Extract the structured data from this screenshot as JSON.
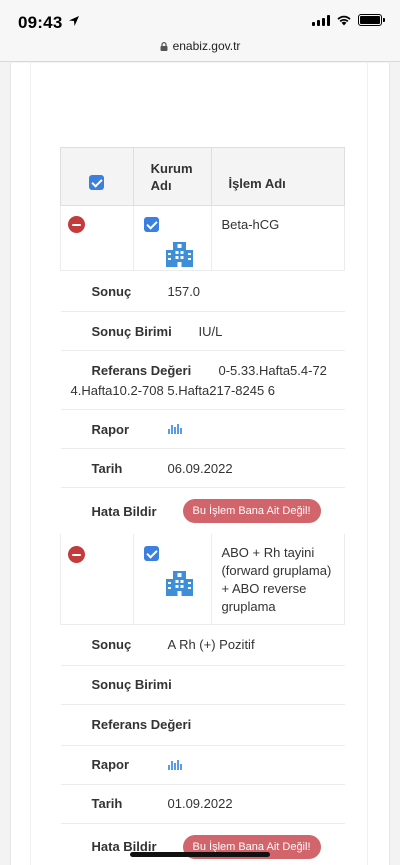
{
  "status_bar": {
    "time": "09:43"
  },
  "browser": {
    "url": "enabiz.gov.tr"
  },
  "table": {
    "header": {
      "kurum": "Kurum\nAdı",
      "islem": "İşlem Adı"
    },
    "labels": {
      "sonuc": "Sonuç",
      "sonuc_birimi": "Sonuç Birimi",
      "referans": "Referans Değeri",
      "rapor": "Rapor",
      "tarih": "Tarih",
      "hata": "Hata Bildir"
    },
    "error_button_label": "Bu İşlem Bana Ait Değil!",
    "records": [
      {
        "islem_adi": "Beta-hCG",
        "sonuc": "157.0",
        "sonuc_birimi": "IU/L",
        "referans_line1": "0-5.33.Hafta5.4-72",
        "referans_line2": "4.Hafta10.2-708 5.Hafta217-8245 6",
        "tarih": "06.09.2022"
      },
      {
        "islem_adi": "ABO + Rh tayini (forward gruplama) + ABO reverse gruplama",
        "sonuc": "A Rh (+) Pozitif",
        "sonuc_birimi": "",
        "referans_line1": "",
        "referans_line2": "",
        "tarih": "01.09.2022"
      }
    ]
  },
  "colors": {
    "checkbox": "#3b7fe0",
    "remove_icon": "#c43b3b",
    "error_button": "#d2646b",
    "hospital_icon": "#3d8fd9"
  }
}
